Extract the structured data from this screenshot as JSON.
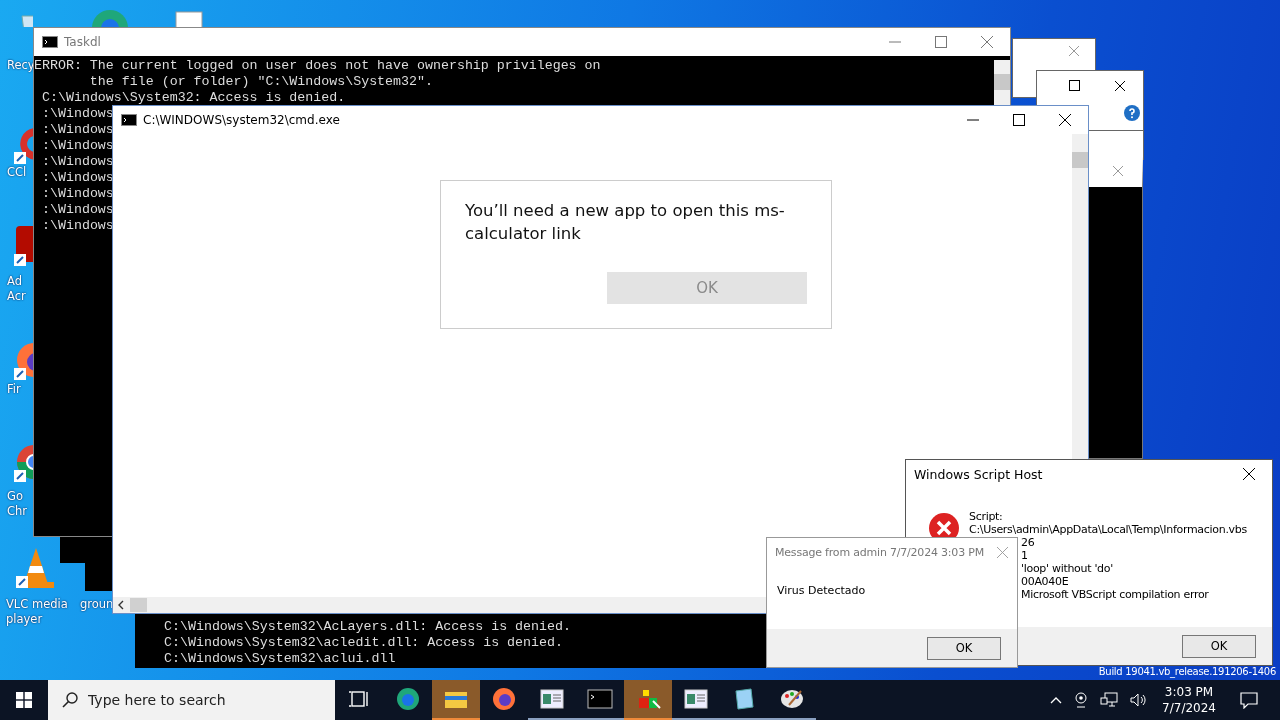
{
  "desktop_icons": [
    {
      "kind": "recycle",
      "lines": [
        "Recy"
      ]
    },
    {
      "kind": "edge"
    },
    {
      "kind": "document"
    },
    {
      "kind": "ccleaner",
      "lines": [
        "CCl"
      ]
    },
    {
      "kind": "acrobat",
      "lines": [
        "Ad",
        "Acr"
      ]
    },
    {
      "kind": "firefox",
      "lines": [
        "Fir"
      ]
    },
    {
      "kind": "chrome",
      "lines": [
        "Go",
        "Chr"
      ]
    },
    {
      "kind": "vlc",
      "lines": [
        "VLC media",
        "player"
      ]
    },
    {
      "kind": "hidden",
      "lines": [
        "groun"
      ]
    }
  ],
  "taskdl_console": {
    "title": "Taskdl",
    "lines": [
      "ERROR: The current logged on user does not have ownership privileges on",
      "       the file (or folder) \"C:\\Windows\\System32\".",
      "C:\\Windows\\System32: Access is denied.",
      ":\\Windows",
      ":\\Windows",
      ":\\Windows",
      ":\\Windows",
      ":\\Windows",
      ":\\Windows",
      ":\\Windows",
      ":\\Windows"
    ]
  },
  "cmd_window": {
    "title": "C:\\WINDOWS\\system32\\cmd.exe"
  },
  "app_dialog": {
    "message": "You’ll need a new app to open this ms-calculator link",
    "button": {
      "label": "OK",
      "disabled": true
    }
  },
  "back_console": {
    "lines": [
      "C:\\Windows\\System32\\AcLayers.dll: Access is denied.",
      "C:\\Windows\\System32\\acledit.dll: Access is denied.",
      "C:\\Windows\\System32\\aclui.dll"
    ]
  },
  "script_host": {
    "title": "Windows Script Host",
    "lines": [
      "Script:",
      "C:\\Users\\admin\\AppData\\Local\\Temp\\Informacion.vbs",
      "26",
      "1",
      "'loop' without 'do'",
      "00A040E",
      "Microsoft VBScript compilation error"
    ],
    "button": "OK"
  },
  "message_box": {
    "title": "Message from admin 7/7/2024 3:03 PM",
    "message": "Virus Detectado",
    "button": "OK"
  },
  "build_text": "Build 19041.vb_release.191206-1406",
  "taskbar": {
    "search": {
      "placeholder": "Type here to search"
    },
    "apps": [
      {
        "kind": "taskview",
        "highlighted": false,
        "running": false
      },
      {
        "kind": "edge",
        "highlighted": false,
        "running": false
      },
      {
        "kind": "explorer",
        "highlighted": true,
        "running": true
      },
      {
        "kind": "firefox",
        "highlighted": false,
        "running": false
      },
      {
        "kind": "window",
        "highlighted": false,
        "running": true
      },
      {
        "kind": "console",
        "highlighted": false,
        "running": true
      },
      {
        "kind": "cube",
        "highlighted": true,
        "running": true
      },
      {
        "kind": "window",
        "highlighted": false,
        "running": true
      },
      {
        "kind": "notepad",
        "highlighted": false,
        "running": true
      },
      {
        "kind": "paint",
        "highlighted": false,
        "running": true
      }
    ],
    "time": "3:03 PM",
    "date": "7/7/2024"
  }
}
